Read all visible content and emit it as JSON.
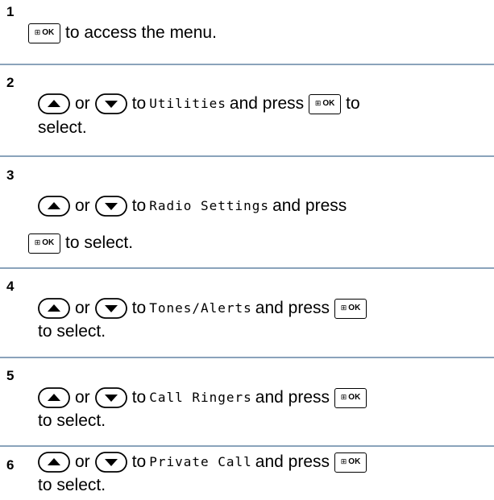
{
  "steps": [
    {
      "number": "1",
      "lines": [
        {
          "parts": [
            {
              "type": "key",
              "icon": "ok-key"
            },
            {
              "type": "text",
              "value": "to access the menu."
            }
          ]
        }
      ]
    },
    {
      "number": "2",
      "lines": [
        {
          "parts": [
            {
              "type": "key",
              "icon": "up-arrow-key"
            },
            {
              "type": "text",
              "value": "or"
            },
            {
              "type": "key",
              "icon": "down-arrow-key"
            },
            {
              "type": "text",
              "value": "to"
            },
            {
              "type": "mono",
              "value": "Utilities"
            },
            {
              "type": "text",
              "value": "and press"
            },
            {
              "type": "key",
              "icon": "ok-key"
            },
            {
              "type": "text",
              "value": "to"
            }
          ]
        },
        {
          "parts": [
            {
              "type": "text",
              "value": "select."
            }
          ]
        }
      ]
    },
    {
      "number": "3",
      "lines": [
        {
          "parts": [
            {
              "type": "key",
              "icon": "up-arrow-key"
            },
            {
              "type": "text",
              "value": "or"
            },
            {
              "type": "key",
              "icon": "down-arrow-key"
            },
            {
              "type": "text",
              "value": "to"
            },
            {
              "type": "mono",
              "value": "Radio Settings"
            },
            {
              "type": "text",
              "value": "and press"
            }
          ]
        },
        {
          "parts": [
            {
              "type": "key",
              "icon": "ok-key"
            },
            {
              "type": "text",
              "value": "to select."
            }
          ]
        }
      ]
    },
    {
      "number": "4",
      "lines": [
        {
          "parts": [
            {
              "type": "key",
              "icon": "up-arrow-key"
            },
            {
              "type": "text",
              "value": "or"
            },
            {
              "type": "key",
              "icon": "down-arrow-key"
            },
            {
              "type": "text",
              "value": "to"
            },
            {
              "type": "mono",
              "value": "Tones/Alerts"
            },
            {
              "type": "text",
              "value": "and press"
            },
            {
              "type": "key",
              "icon": "ok-key"
            }
          ]
        },
        {
          "parts": [
            {
              "type": "text",
              "value": "to select."
            }
          ]
        }
      ]
    },
    {
      "number": "5",
      "lines": [
        {
          "parts": [
            {
              "type": "key",
              "icon": "up-arrow-key"
            },
            {
              "type": "text",
              "value": "or"
            },
            {
              "type": "key",
              "icon": "down-arrow-key"
            },
            {
              "type": "text",
              "value": "to"
            },
            {
              "type": "mono",
              "value": "Call Ringers"
            },
            {
              "type": "text",
              "value": "and press"
            },
            {
              "type": "key",
              "icon": "ok-key"
            }
          ]
        },
        {
          "parts": [
            {
              "type": "text",
              "value": "to select."
            }
          ]
        }
      ]
    },
    {
      "number": "6",
      "lines": [
        {
          "parts": [
            {
              "type": "key",
              "icon": "up-arrow-key"
            },
            {
              "type": "text",
              "value": "or"
            },
            {
              "type": "key",
              "icon": "down-arrow-key"
            },
            {
              "type": "text",
              "value": "to"
            },
            {
              "type": "mono",
              "value": "Private Call"
            },
            {
              "type": "text",
              "value": "and press"
            },
            {
              "type": "key",
              "icon": "ok-key"
            }
          ]
        },
        {
          "parts": [
            {
              "type": "text",
              "value": "to select."
            }
          ]
        }
      ]
    }
  ],
  "ok_key": {
    "label": "OK",
    "glyph": "⊞"
  },
  "colors": {
    "divider": "#8aa3bb",
    "text": "#000000"
  }
}
